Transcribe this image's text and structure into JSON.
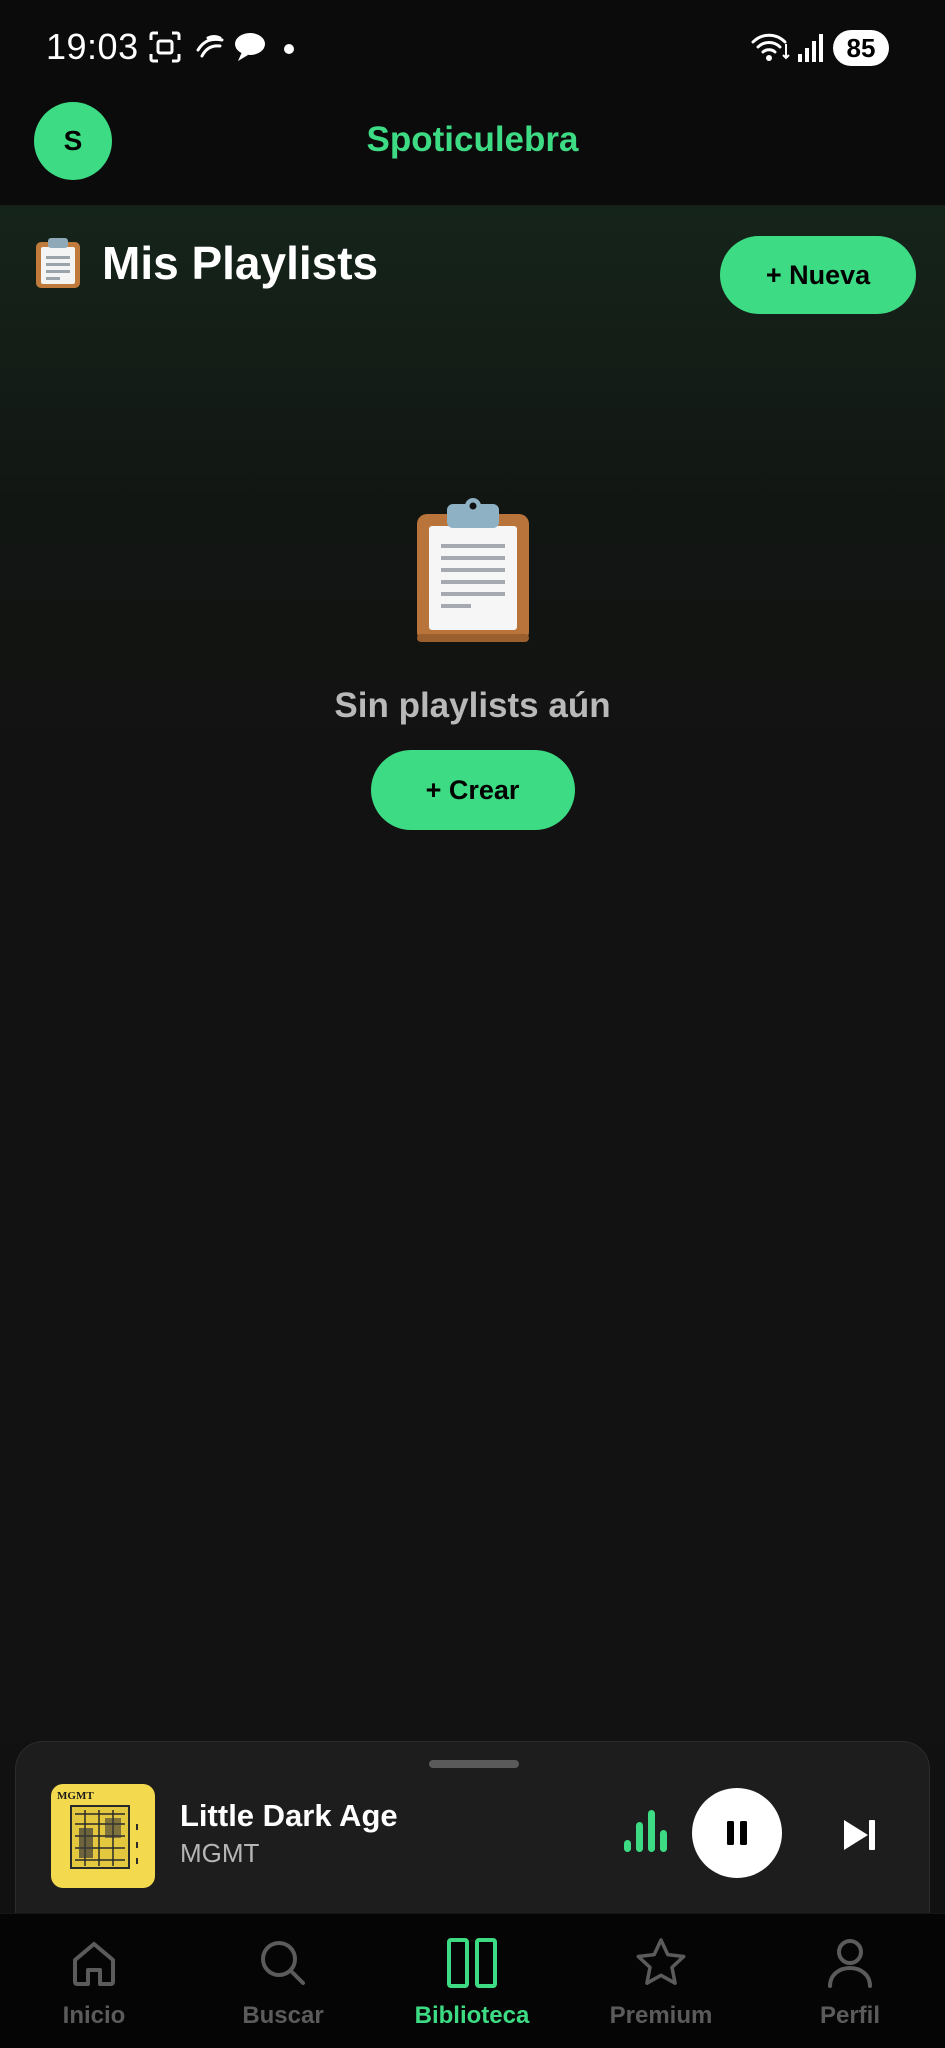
{
  "status_bar": {
    "time": "19:03",
    "battery": "85",
    "icons": [
      "screenshot-icon",
      "fan-icon",
      "chat-bubble-icon",
      "notification-dot",
      "wifi-icon",
      "signal-icon",
      "battery-icon"
    ]
  },
  "header": {
    "avatar_initial": "S",
    "app_title": "Spoticulebra"
  },
  "library": {
    "title": "Mis Playlists",
    "title_icon": "clipboard-icon",
    "new_button": "+ Nueva",
    "empty_text": "Sin playlists aún",
    "create_button": "+ Crear"
  },
  "player": {
    "title": "Little Dark Age",
    "artist": "MGMT",
    "cover_text": "MGMT",
    "state": "playing"
  },
  "nav": {
    "items": [
      {
        "label": "Inicio",
        "icon": "home-icon",
        "active": false
      },
      {
        "label": "Buscar",
        "icon": "search-icon",
        "active": false
      },
      {
        "label": "Biblioteca",
        "icon": "library-icon",
        "active": true
      },
      {
        "label": "Premium",
        "icon": "star-icon",
        "active": false
      },
      {
        "label": "Perfil",
        "icon": "person-icon",
        "active": false
      }
    ]
  },
  "colors": {
    "accent": "#3ddc84",
    "background": "#121212",
    "inactive": "#5b5b5b"
  }
}
